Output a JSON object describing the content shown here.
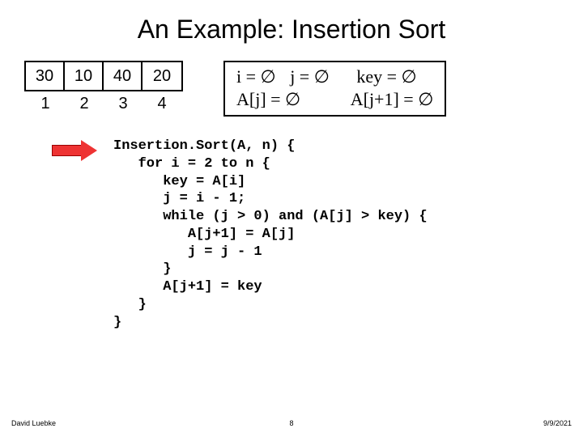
{
  "title": "An Example: Insertion Sort",
  "array": {
    "cells": [
      "30",
      "10",
      "40",
      "20"
    ],
    "indices": [
      "1",
      "2",
      "3",
      "4"
    ]
  },
  "state": {
    "i": "i = ∅",
    "j": "j = ∅",
    "key": "key = ∅",
    "aj": "A[j] = ∅",
    "aj1": "A[j+1] = ∅"
  },
  "code": "Insertion.Sort(A, n) {\n   for i = 2 to n {\n      key = A[i]\n      j = i - 1;\n      while (j > 0) and (A[j] > key) {\n         A[j+1] = A[j]\n         j = j - 1\n      }\n      A[j+1] = key\n   }\n}",
  "footer": {
    "author": "David Luebke",
    "page": "8",
    "date": "9/9/2021"
  }
}
